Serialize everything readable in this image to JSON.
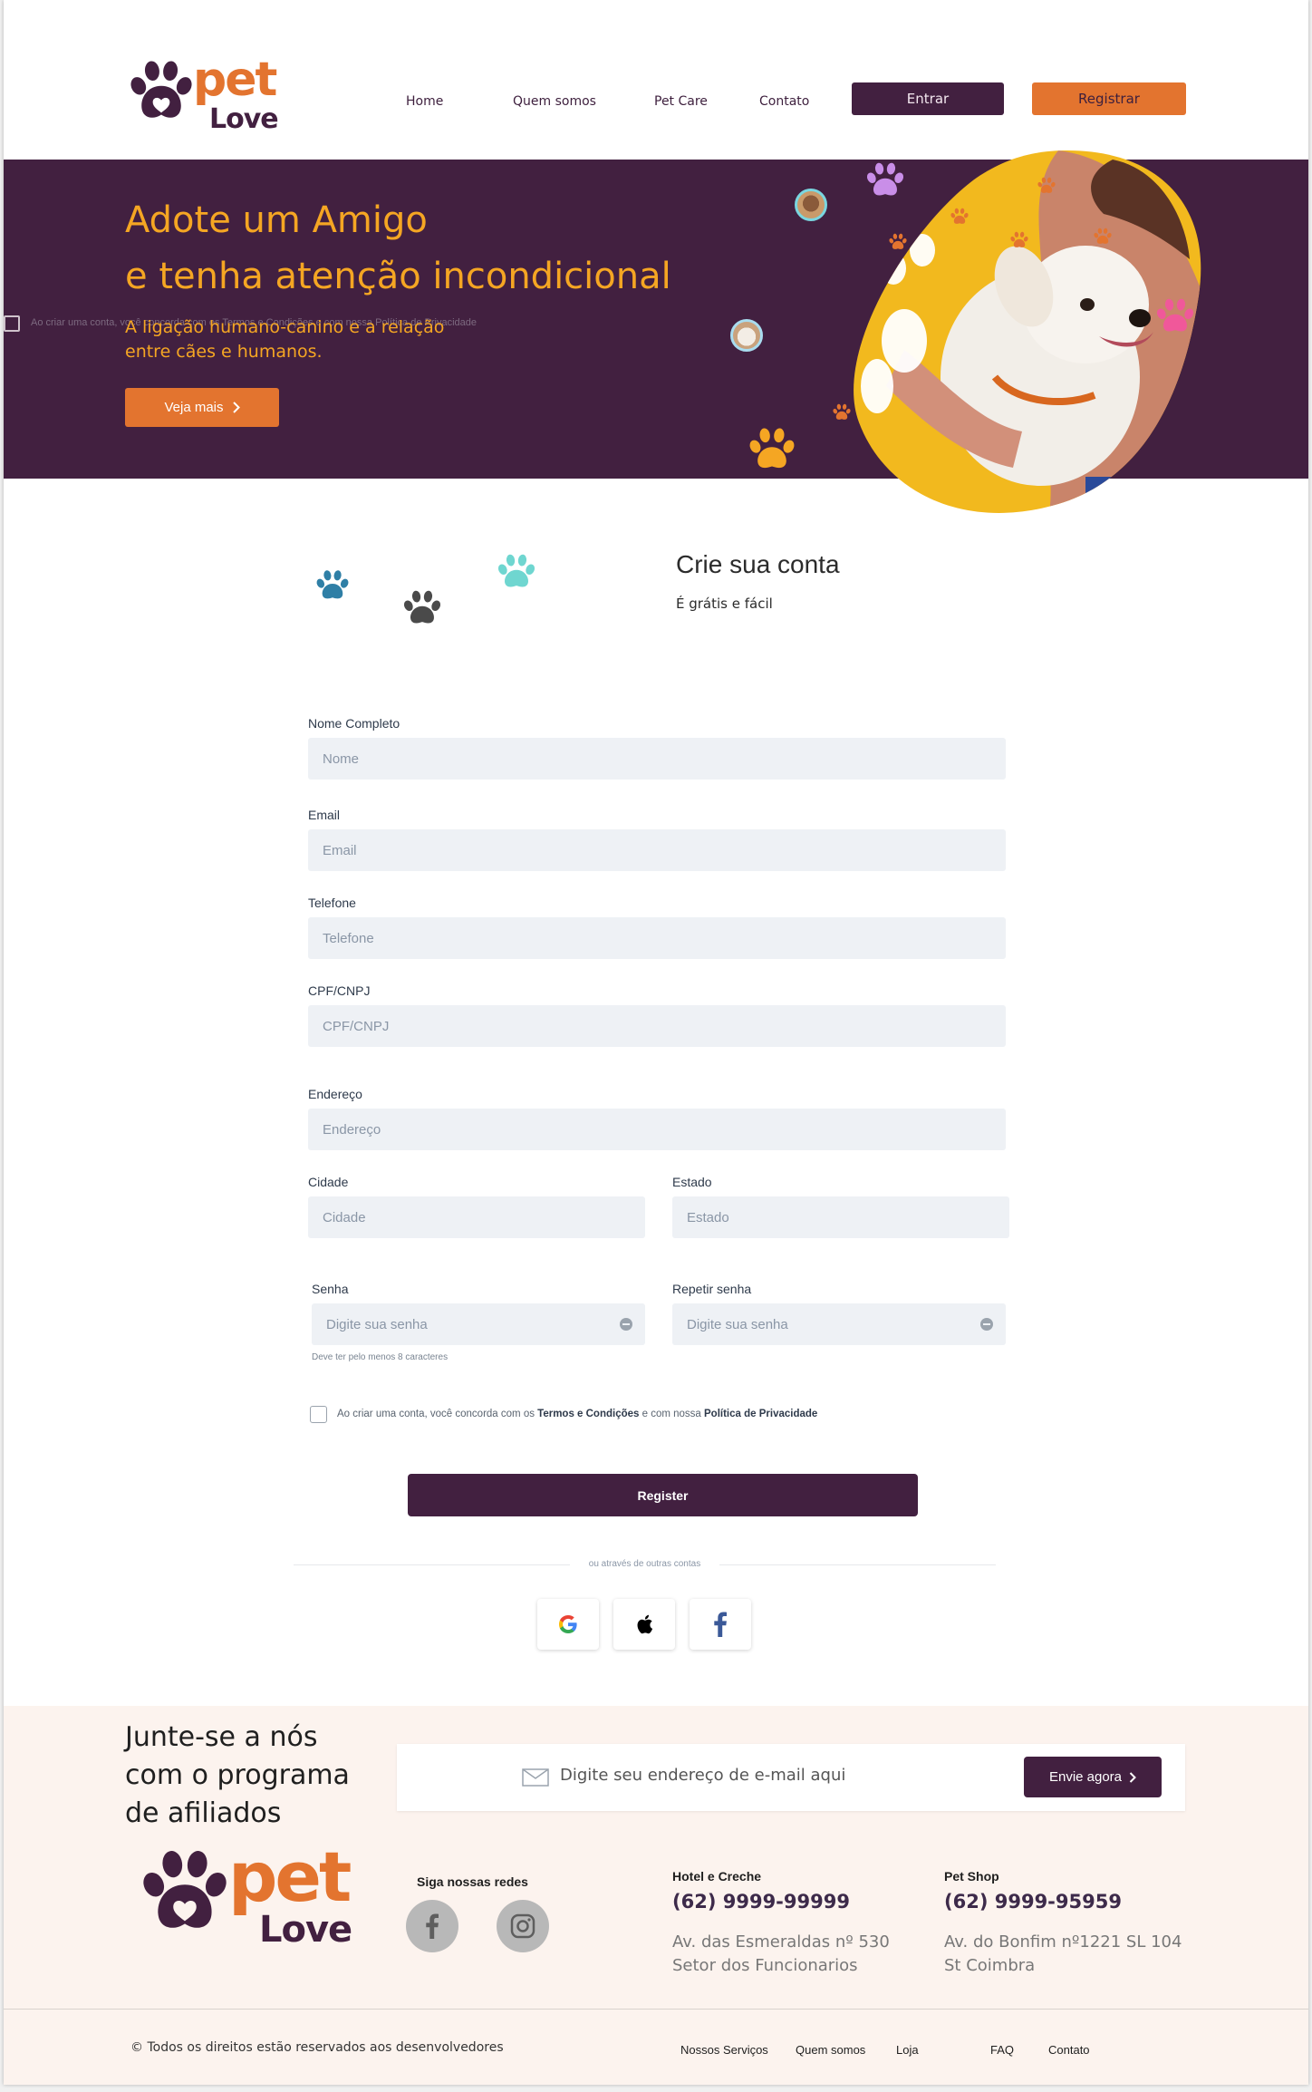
{
  "brand": {
    "name_top": "pet",
    "name_bottom": "Love",
    "colors": {
      "plum": "#422040",
      "orange": "#e3742f",
      "yellow": "#f2b91e"
    }
  },
  "nav": {
    "home": "Home",
    "about": "Quem somos",
    "petcare": "Pet Care",
    "contact": "Contato",
    "login": "Entrar",
    "register": "Registrar"
  },
  "hero": {
    "title_line1": "Adote um Amigo",
    "title_line2": "e tenha atenção incondicional",
    "subtitle_line1": "A ligação humano-canino e a relação",
    "subtitle_line2": "entre cães e humanos.",
    "cta": "Veja mais",
    "ghost_text": "Ao criar uma conta, você concorda com os Termos e Condições e com nossa Política de Privacidade"
  },
  "signup": {
    "title": "Crie sua conta",
    "subtitle": "É grátis e fácil",
    "fields": {
      "name": {
        "label": "Nome Completo",
        "placeholder": "Nome"
      },
      "email": {
        "label": "Email",
        "placeholder": "Email"
      },
      "phone": {
        "label": "Telefone",
        "placeholder": "Telefone"
      },
      "doc": {
        "label": "CPF/CNPJ",
        "placeholder": "CPF/CNPJ"
      },
      "address": {
        "label": "Endereço",
        "placeholder": "Endereço"
      },
      "city": {
        "label": "Cidade",
        "placeholder": "Cidade"
      },
      "state": {
        "label": "Estado",
        "placeholder": "Estado"
      },
      "password": {
        "label": "Senha",
        "placeholder": "Digite sua senha",
        "hint": "Deve ter pelo menos 8 caracteres"
      },
      "password2": {
        "label": "Repetir senha",
        "placeholder": "Digite sua senha"
      }
    },
    "terms": {
      "prefix": "Ao criar uma conta, você concorda com os ",
      "terms_link": "Termos e Condições",
      "middle": " e com nossa ",
      "privacy_link": "Política de Privacidade"
    },
    "submit": "Register",
    "divider": "ou através de outras contas",
    "social": [
      "google-icon",
      "apple-icon",
      "facebook-icon"
    ]
  },
  "footer": {
    "affiliate_line1": "Junte-se a nós",
    "affiliate_line2": "com o programa",
    "affiliate_line3": "de afiliados",
    "newsletter_placeholder": "Digite seu endereço de e-mail aqui",
    "newsletter_button": "Envie agora",
    "social_title": "Siga nossas redes",
    "hotel": {
      "title": "Hotel e Creche",
      "phone": "(62) 9999-99999",
      "addr1": "Av. das Esmeraldas nº 530",
      "addr2": "Setor dos Funcionarios"
    },
    "shop": {
      "title": "Pet Shop",
      "phone": "(62) 9999-95959",
      "addr1": "Av. do Bonfim nº1221 SL 104",
      "addr2": "St Coimbra"
    },
    "copyright": "© Todos os direitos estão reservados aos desenvolvedores",
    "links": {
      "services": "Nossos Serviços",
      "about": "Quem somos",
      "store": "Loja",
      "faq": "FAQ",
      "contact": "Contato"
    }
  }
}
